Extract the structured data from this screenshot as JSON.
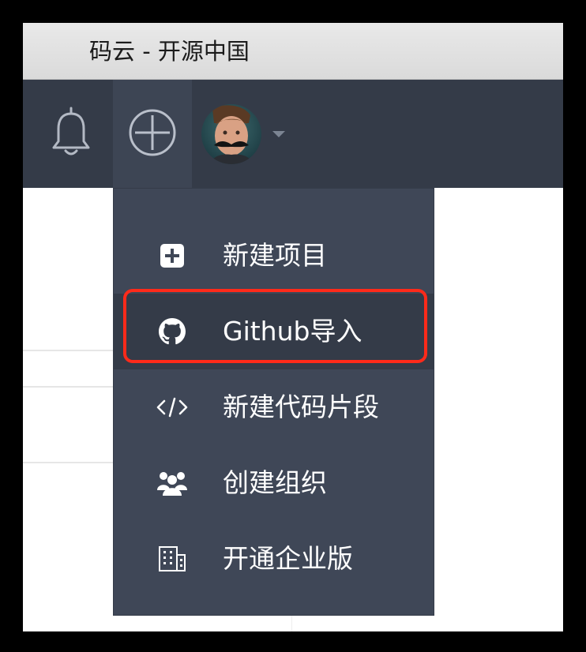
{
  "window": {
    "title": "码云 - 开源中国"
  },
  "navbar": {
    "bell_icon": "bell-icon",
    "plus_icon": "plus-circle-icon",
    "avatar_icon": "user-avatar",
    "caret_icon": "caret-down-icon"
  },
  "dropdown": {
    "items": [
      {
        "label": "新建项目",
        "icon": "plus-square-icon"
      },
      {
        "label": "Github导入",
        "icon": "github-icon"
      },
      {
        "label": "新建代码片段",
        "icon": "code-icon"
      },
      {
        "label": "创建组织",
        "icon": "users-icon"
      },
      {
        "label": "开通企业版",
        "icon": "building-icon"
      }
    ]
  },
  "colors": {
    "navbar": "#343b48",
    "dropdown": "#3f4757",
    "highlight": "#ff2a1a"
  }
}
